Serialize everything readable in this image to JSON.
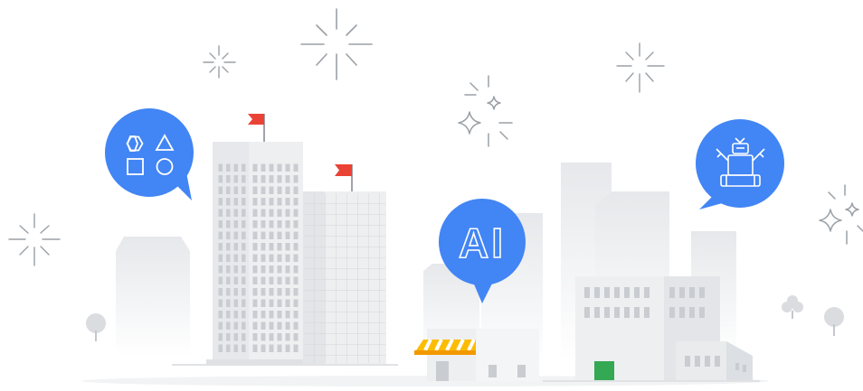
{
  "illustration": {
    "ai_badge_label": "AI",
    "colors": {
      "bubble_blue": "#4285f4",
      "flag_red": "#ea4335",
      "awning_yellow": "#fbbc04",
      "door_green": "#34a853",
      "building_light": "#eeeff1",
      "building_mid": "#e1e3e6",
      "window_gray": "#c9ccd1",
      "sparkle_gray": "#9aa0a6"
    },
    "icons": [
      "shapes-icon",
      "ai-icon",
      "robot-icon",
      "flag-icon",
      "sparkle-icon",
      "star-sparkle-icon",
      "tree-icon"
    ]
  }
}
